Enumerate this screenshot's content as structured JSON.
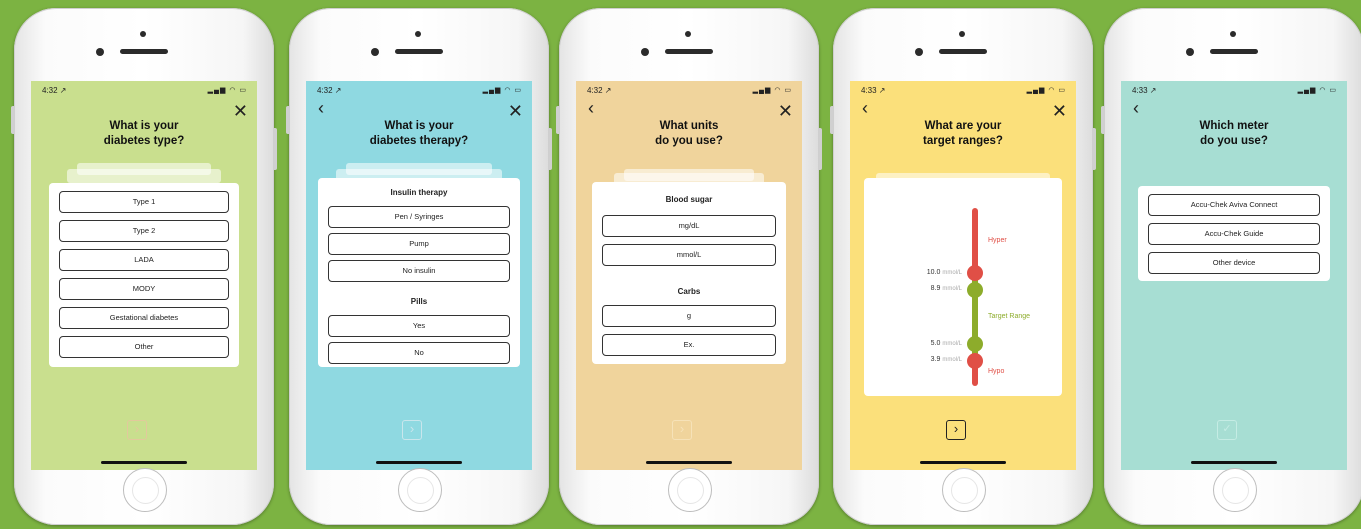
{
  "status": {
    "signal": "▂▄▆ ◠ ▭"
  },
  "icons": {
    "close": "✕",
    "back": "‹",
    "next": "›",
    "check": "✓"
  },
  "colors": {
    "background": "#7cb342",
    "screen1": "#c9df8e",
    "screen2": "#8fd9e1",
    "screen3": "#f0d49c",
    "screen4": "#fbe07b",
    "screen5": "#a7ded3",
    "hyper": "#e04f46",
    "target": "#8dac2b"
  },
  "screens": [
    {
      "time": "4:32 ↗",
      "title": "What is your\ndiabetes type?",
      "options": [
        "Type 1",
        "Type 2",
        "LADA",
        "MODY",
        "Gestational diabetes",
        "Other"
      ]
    },
    {
      "time": "4:32 ↗",
      "title": "What is your\ndiabetes therapy?",
      "section1": "Insulin therapy",
      "options1": [
        "Pen / Syringes",
        "Pump",
        "No insulin"
      ],
      "section2": "Pills",
      "options2": [
        "Yes",
        "No"
      ]
    },
    {
      "time": "4:32 ↗",
      "title": "What units\ndo you use?",
      "section1": "Blood sugar",
      "options1": [
        "mg/dL",
        "mmol/L"
      ],
      "section2": "Carbs",
      "options2": [
        "g",
        "Ex."
      ]
    },
    {
      "time": "4:33 ↗",
      "title": "What are your\ntarget ranges?",
      "labels": {
        "hyper": "Hyper",
        "target": "Target Range",
        "hypo": "Hypo"
      },
      "values": [
        {
          "num": "10.0",
          "unit": "mmol/L"
        },
        {
          "num": "8.9",
          "unit": "mmol/L"
        },
        {
          "num": "5.0",
          "unit": "mmol/L"
        },
        {
          "num": "3.9",
          "unit": "mmol/L"
        }
      ]
    },
    {
      "time": "4:33 ↗",
      "title": "Which meter\ndo you use?",
      "options": [
        "Accu-Chek Aviva Connect",
        "Accu-Chek Guide",
        "Other device"
      ]
    }
  ]
}
